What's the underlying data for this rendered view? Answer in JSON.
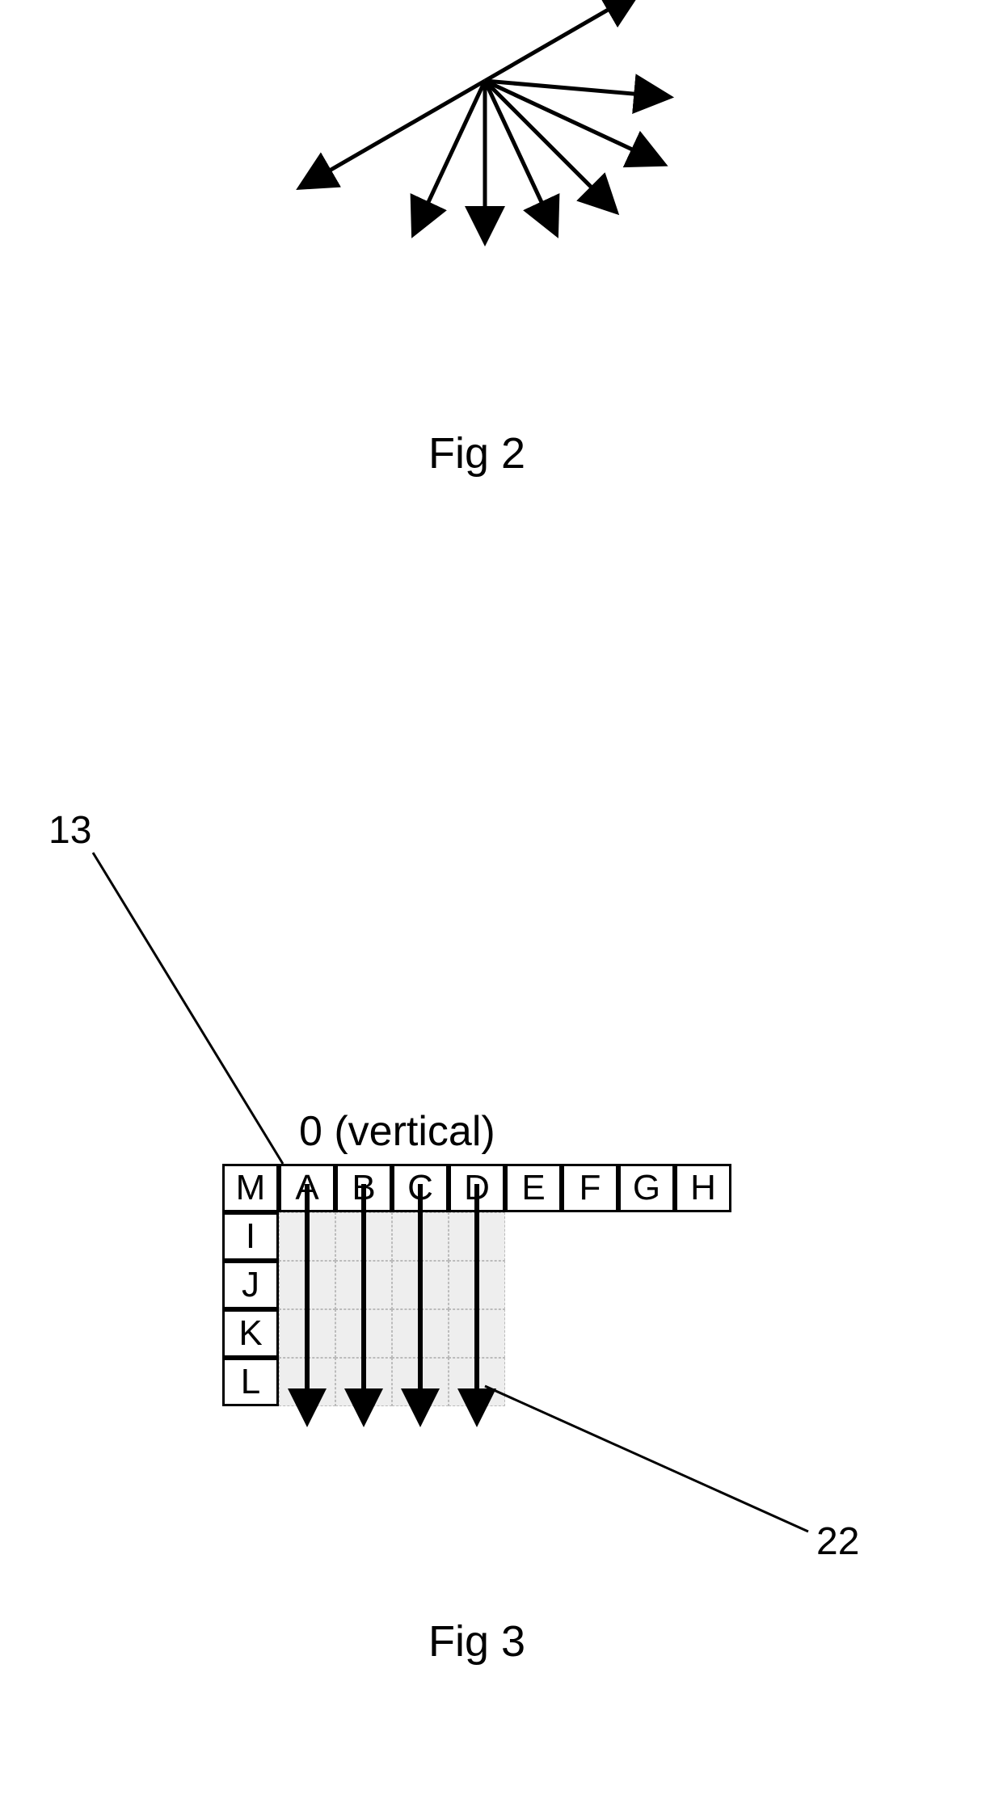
{
  "fig2": {
    "label": "Fig 2",
    "arrows": [
      {
        "angle_deg": -30,
        "len": 190
      },
      {
        "angle_deg": 5,
        "len": 200
      },
      {
        "angle_deg": 25,
        "len": 215
      },
      {
        "angle_deg": 45,
        "len": 200
      },
      {
        "angle_deg": 65,
        "len": 180
      },
      {
        "angle_deg": 90,
        "len": 170
      },
      {
        "angle_deg": 115,
        "len": 180
      },
      {
        "angle_deg": 150,
        "len": 235
      }
    ]
  },
  "fig3": {
    "label": "Fig 3",
    "mode_label": "0 (vertical)",
    "ref_13": "13",
    "ref_22": "22",
    "top_row": [
      "M",
      "A",
      "B",
      "C",
      "D",
      "E",
      "F",
      "G",
      "H"
    ],
    "left_col": [
      "I",
      "J",
      "K",
      "L"
    ],
    "block_size": 4
  }
}
